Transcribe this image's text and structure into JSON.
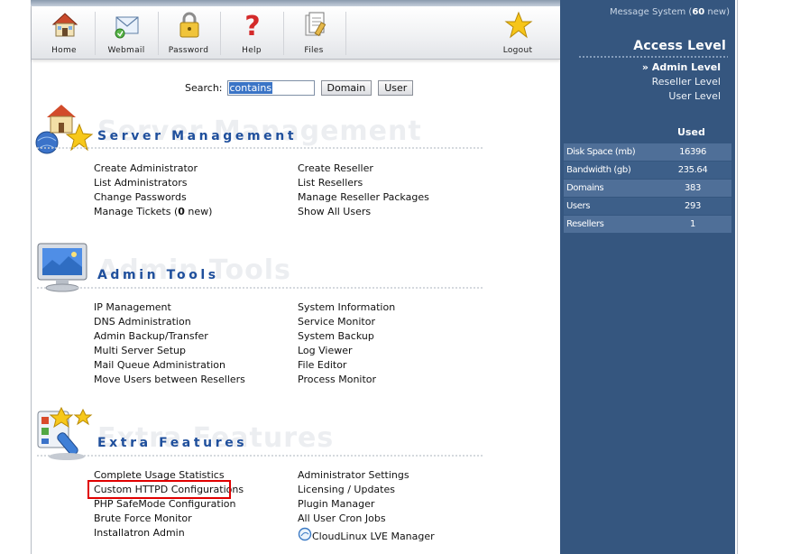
{
  "toolbar": {
    "items": [
      {
        "label": "Home",
        "icon": "house-icon"
      },
      {
        "label": "Webmail",
        "icon": "mail-icon"
      },
      {
        "label": "Password",
        "icon": "padlock-icon"
      },
      {
        "label": "Help",
        "icon": "question-mark-icon"
      },
      {
        "label": "Files",
        "icon": "files-icon"
      },
      {
        "label": "Logout",
        "icon": "star-icon"
      }
    ]
  },
  "message_system": {
    "prefix": "Message System (",
    "count": "60",
    "suffix": " new)"
  },
  "access": {
    "title": "Access Level",
    "levels": [
      "» Admin Level",
      "Reseller Level",
      "User Level"
    ],
    "active_level": "Admin Level"
  },
  "stats": {
    "header": "Used",
    "rows": [
      {
        "label": "Disk Space (mb)",
        "value": "16396"
      },
      {
        "label": "Bandwidth (gb)",
        "value": "235.64"
      },
      {
        "label": "Domains",
        "value": "383"
      },
      {
        "label": "Users",
        "value": "293"
      },
      {
        "label": "Resellers",
        "value": "1"
      }
    ]
  },
  "search": {
    "label": "Search:",
    "value": "contains",
    "domain_button": "Domain",
    "user_button": "User"
  },
  "sections": {
    "server": {
      "title": "Server Management",
      "watermark": "Server Management",
      "left": [
        "Create Administrator",
        "List Administrators",
        "Change Passwords"
      ],
      "tickets": {
        "prefix": "Manage Tickets (",
        "count": "0",
        "suffix": " new)"
      },
      "right": [
        "Create Reseller",
        "List Resellers",
        "Manage Reseller Packages",
        "Show All Users"
      ]
    },
    "admin": {
      "title": "Admin Tools",
      "watermark": "Admin Tools",
      "left": [
        "IP Management",
        "DNS Administration",
        "Admin Backup/Transfer",
        "Multi Server Setup",
        "Mail Queue Administration",
        "Move Users between Resellers"
      ],
      "right": [
        "System Information",
        "Service Monitor",
        "System Backup",
        "Log Viewer",
        "File Editor",
        "Process Monitor"
      ]
    },
    "extra": {
      "title": "Extra Features",
      "watermark": "Extra Features",
      "left": [
        "Complete Usage Statistics",
        "Custom HTTPD Configurations",
        "PHP SafeMode Configuration",
        "Brute Force Monitor",
        "Installatron Admin"
      ],
      "right": [
        "Administrator Settings",
        "Licensing / Updates",
        "Plugin Manager",
        "All User Cron Jobs",
        "CloudLinux LVE Manager"
      ]
    }
  },
  "colors": {
    "panel": "#35567f",
    "section_title": "#1f4f9c",
    "highlight": "#e00000"
  }
}
